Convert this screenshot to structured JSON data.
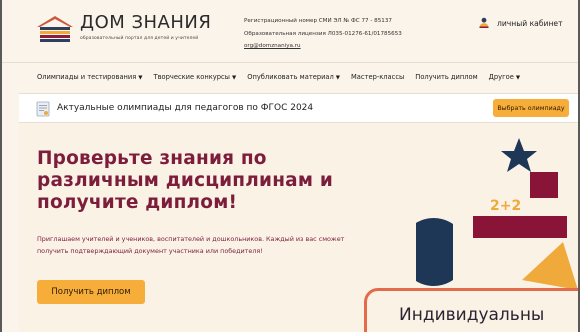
{
  "brand": {
    "name": "ДОМ ЗНАНИЯ",
    "subtitle": "образовательный портал для детей и учителей"
  },
  "registration": {
    "line1": "Регистрационный номер СМИ ЭЛ № ФС 77 - 85137",
    "line2": "Образовательная лицензия Л035-01276-61/01785653",
    "email": "org@domznaniya.ru"
  },
  "cabinet": {
    "label": "личный кабинет",
    "icon": "user-icon"
  },
  "nav": {
    "items": [
      {
        "label": "Олимпиады и тестирования",
        "caret": "▼"
      },
      {
        "label": "Творческие конкурсы",
        "caret": "▼"
      },
      {
        "label": "Опубликовать материал",
        "caret": "▼"
      },
      {
        "label": "Мастер-классы",
        "caret": ""
      },
      {
        "label": "Получить диплом",
        "caret": ""
      },
      {
        "label": "Другое",
        "caret": "▼"
      }
    ]
  },
  "olympiad_bar": {
    "text": "Актуальные олимпиады для педагогов по ФГОС 2024",
    "button": "Выбрать олимпиаду",
    "icon": "document-icon"
  },
  "hero": {
    "title": "Проверьте знания по различным дисциплинам и получите диплом!",
    "description": "Приглашаем учителей и учеников, воспитателей и дошкольников. Каждый из вас сможет получить подтверждающий документ участника или победителя!",
    "button": "Получить диплом",
    "math_label": "2+2"
  },
  "card": {
    "title": "Индивидуальны"
  },
  "colors": {
    "accent": "#f7ad3a",
    "title": "#7c1d3c",
    "background": "#fbf4ea",
    "navy": "#1f3756",
    "crimson": "#8a1338",
    "card_border": "#e36a4a"
  }
}
